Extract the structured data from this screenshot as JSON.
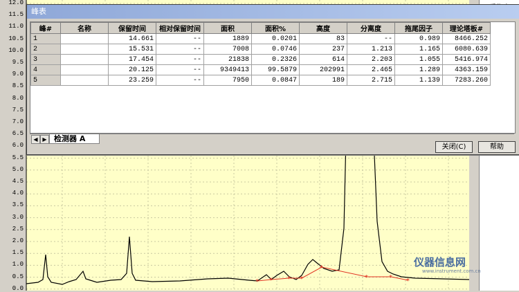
{
  "window": {
    "title": "峰表"
  },
  "table": {
    "columns": [
      "峰#",
      "名称",
      "保留时间",
      "相对保留时间",
      "面积",
      "面积%",
      "高度",
      "分离度",
      "拖尾因子",
      "理论塔板#"
    ],
    "rows": [
      [
        "1",
        "",
        "14.661",
        "--",
        "1889",
        "0.0201",
        "83",
        "--",
        "0.989",
        "8466.252"
      ],
      [
        "2",
        "",
        "15.531",
        "--",
        "7008",
        "0.0746",
        "237",
        "1.213",
        "1.165",
        "6080.639"
      ],
      [
        "3",
        "",
        "17.454",
        "--",
        "21838",
        "0.2326",
        "614",
        "2.203",
        "1.055",
        "5416.974"
      ],
      [
        "4",
        "",
        "20.125",
        "--",
        "9349413",
        "99.5879",
        "202991",
        "2.465",
        "1.289",
        "4363.159"
      ],
      [
        "5",
        "",
        "23.259",
        "--",
        "7950",
        "0.0847",
        "189",
        "2.715",
        "1.139",
        "7283.260"
      ]
    ]
  },
  "tab": {
    "label": "检测器 A"
  },
  "buttons": {
    "close": "关闭(C)",
    "help": "帮助"
  },
  "right_panel": {
    "header": "[采集率]"
  },
  "y_axis": {
    "ticks": [
      "12.0",
      "11.5",
      "11.0",
      "10.5",
      "10.0",
      "9.5",
      "9.0",
      "8.5",
      "8.0",
      "7.5",
      "7.0",
      "6.5",
      "6.0",
      "5.5",
      "5.0",
      "4.5",
      "4.0",
      "3.5",
      "3.0",
      "2.5",
      "2.0",
      "1.5",
      "1.0",
      "0.5",
      "0.0"
    ]
  },
  "watermark": {
    "text": "仪器信息网",
    "sub": "www.instrument.com.cn"
  },
  "colors": {
    "plot_bg": "#ffffc8",
    "trace": "#000000",
    "marker": "#e03020"
  }
}
